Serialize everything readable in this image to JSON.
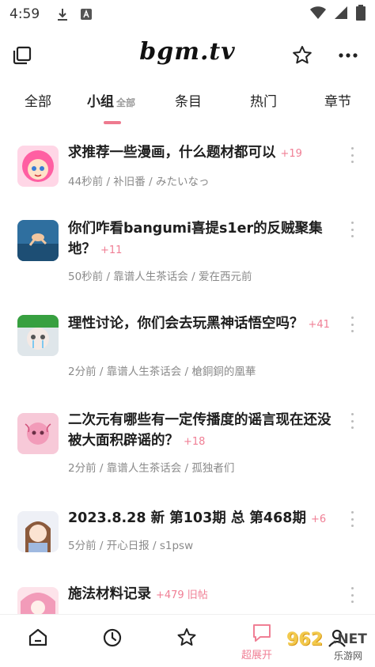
{
  "status_bar": {
    "time": "4:59"
  },
  "app_bar": {
    "title": "bgm.tv"
  },
  "tabs": [
    {
      "label": "全部"
    },
    {
      "label": "小组",
      "sub": "全部",
      "active": true
    },
    {
      "label": "条目"
    },
    {
      "label": "热门"
    },
    {
      "label": "章节"
    }
  ],
  "topics": [
    {
      "title": "求推荐一些漫画，什么题材都可以",
      "replies": "+19",
      "meta": "44秒前 / 补旧番 / みたいなっ",
      "avatar": "pink-hair-anime-avatar"
    },
    {
      "title": "你们咋看bangumi喜提s1er的反贼聚集地？",
      "replies": "+11",
      "meta": "50秒前 / 靠谱人生茶话会 / 爱在西元前",
      "avatar": "underwater-baby-avatar"
    },
    {
      "title": "理性讨论，你们会去玩黑神话悟空吗？",
      "replies": "+41",
      "meta": "2分前 / 靠谱人生茶话会 / 槍銅銅的凰華",
      "avatar": "crying-character-avatar"
    },
    {
      "title": "二次元有哪些有一定传播度的谣言现在还没被大面积辟谣的？",
      "replies": "+18",
      "meta": "2分前 / 靠谱人生茶话会 / 孤独者们",
      "avatar": "pink-doodle-avatar"
    },
    {
      "title": "2023.8.28 新 第103期 总 第468期",
      "replies": "+6",
      "meta": "5分前 / 开心日报 / s1psw",
      "avatar": "anime-girl-avatar"
    },
    {
      "title": "施法材料记录",
      "replies": "+479",
      "extra": "旧帖",
      "meta": "",
      "avatar": "pink-hair-avatar"
    }
  ],
  "bottom_nav": {
    "active_label": "超展开"
  },
  "watermark": {
    "num": "962",
    "net": ".NET",
    "sub": "乐游网"
  },
  "colors": {
    "accent": "#f07f95",
    "indicator": "#ee7a8f"
  }
}
